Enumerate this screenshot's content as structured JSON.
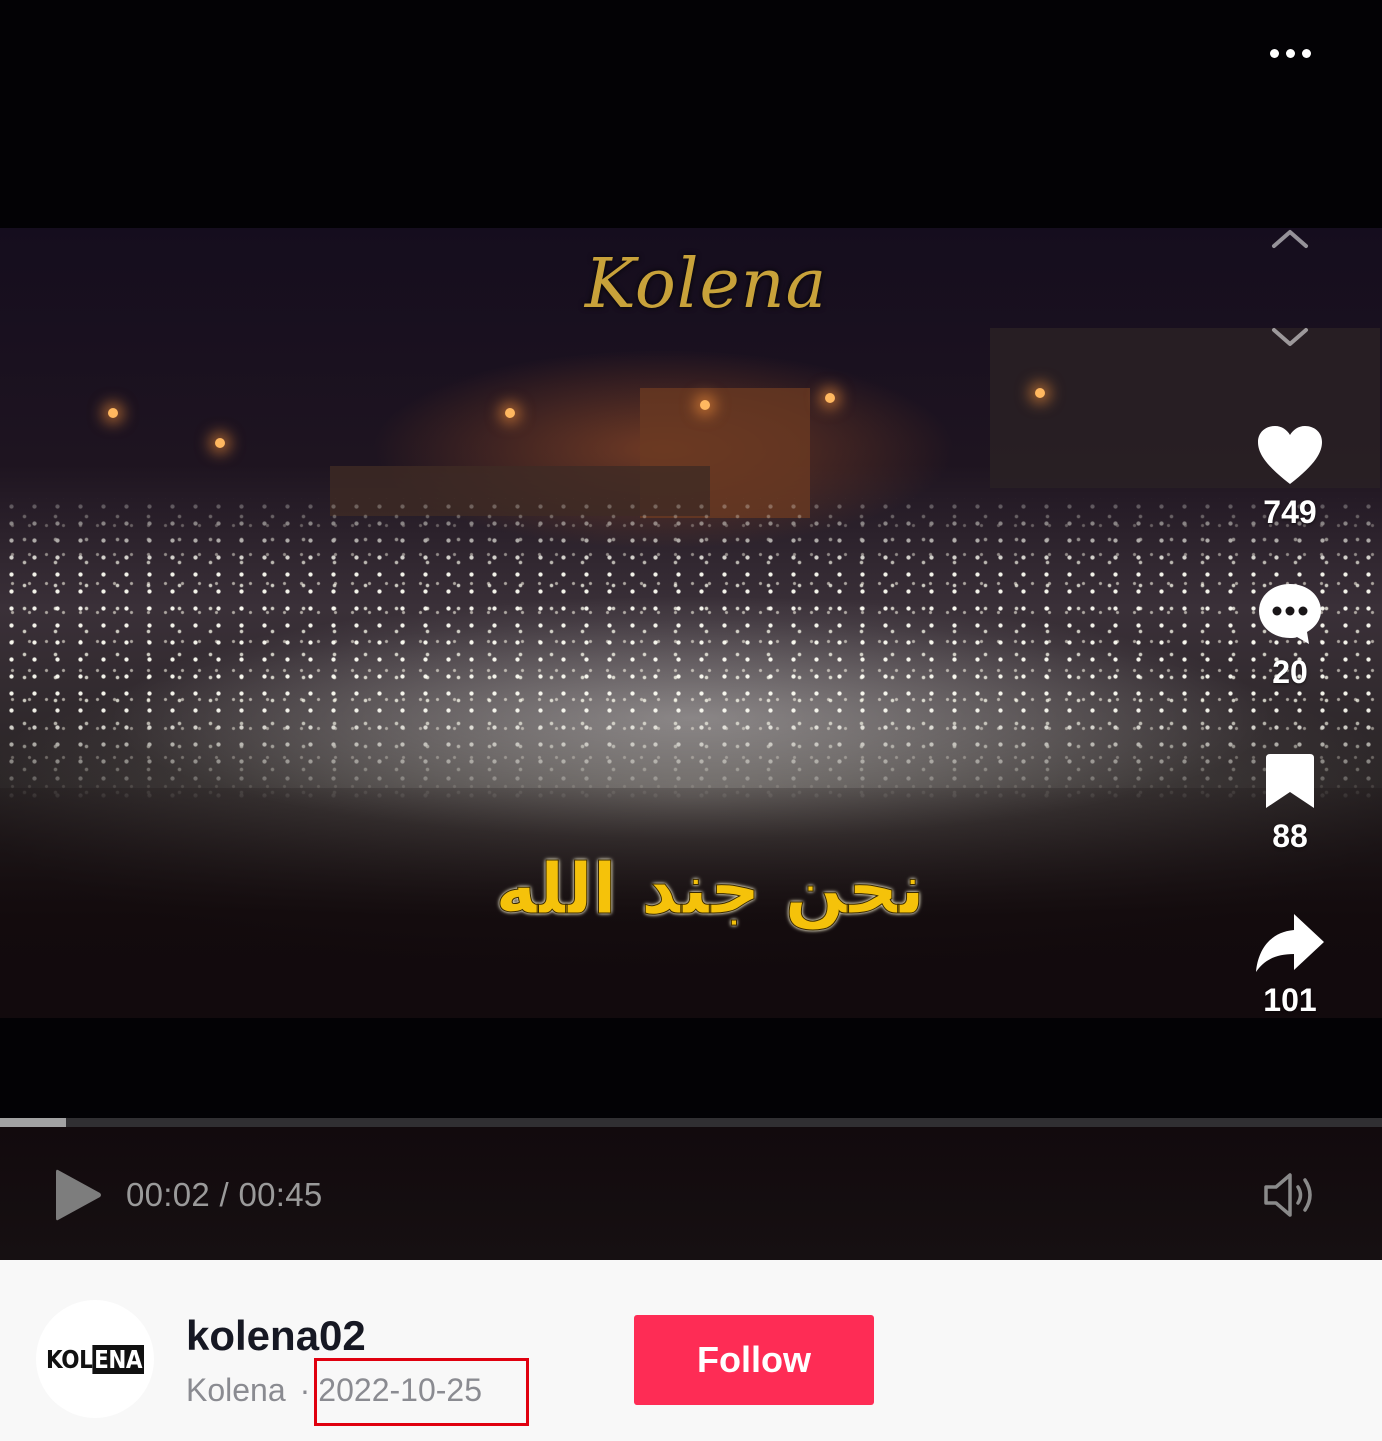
{
  "video": {
    "watermark": "Kolena",
    "caption": "نحن جند الله",
    "progress_fraction": 0.048
  },
  "actions": {
    "like_count": "749",
    "comment_count": "20",
    "save_count": "88",
    "share_count": "101"
  },
  "player": {
    "current_time": "00:02",
    "separator": " / ",
    "total_time": "00:45",
    "icons": [
      "more-icon",
      "chevron-up-icon",
      "chevron-down-icon",
      "heart-icon",
      "comment-icon",
      "bookmark-icon",
      "share-icon",
      "play-icon",
      "volume-icon"
    ]
  },
  "author": {
    "avatar_text_main": "KOL",
    "avatar_text_accent": "ENA",
    "username": "kolena02",
    "nickname": "Kolena",
    "separator": "·",
    "post_date": "2022-10-25",
    "follow_label": "Follow"
  },
  "colors": {
    "follow_button": "#fe2c55",
    "caption_text": "#f5c20a",
    "date_highlight_border": "#e0000f"
  }
}
